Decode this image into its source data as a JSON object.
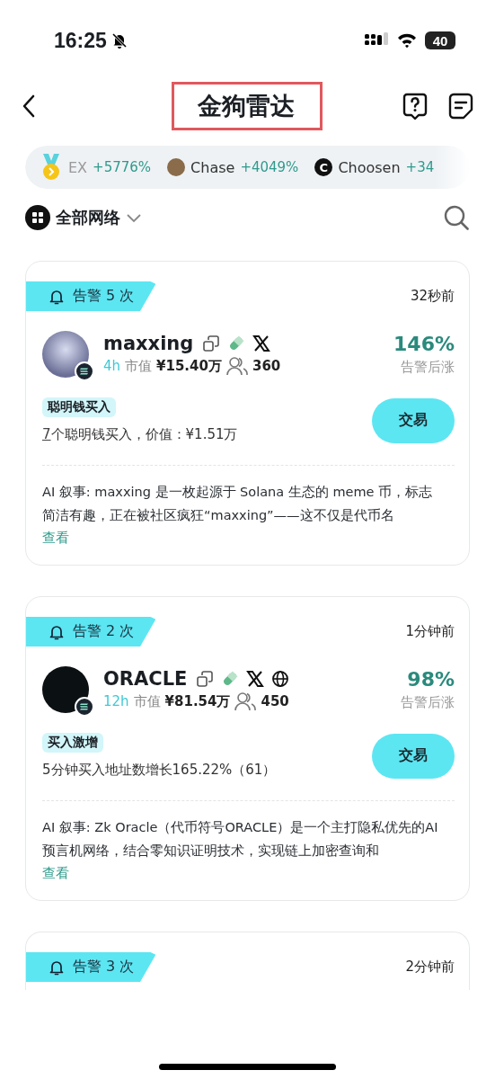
{
  "status_bar": {
    "time": "16:25",
    "battery": "40"
  },
  "header": {
    "title": "金狗雷达"
  },
  "ticker": [
    {
      "kind": "medal",
      "name": "EX",
      "change": "+5776%"
    },
    {
      "kind": "photo",
      "name": "Chase",
      "change": "+4049%"
    },
    {
      "kind": "letter",
      "name": "Choosen",
      "change": "+34",
      "logo": "C"
    }
  ],
  "network_filter": {
    "label": "全部网络"
  },
  "cards": [
    {
      "alert": "告警 5 次",
      "time": "32秒前",
      "kind": "photo",
      "name": "maxxing",
      "links": [
        {
          "kind": "copy"
        },
        {
          "kind": "pill"
        },
        {
          "kind": "x"
        }
      ],
      "age": "4h",
      "mcap_label": "市值",
      "mcap": "¥15.40万",
      "holders": "360",
      "gain": "146%",
      "gain_label": "告警后涨",
      "tag": "聪明钱买入",
      "detail_link": "7",
      "detail": "个聪明钱买入，价值：¥1.51万",
      "trade": "交易",
      "description": "AI 叙事: maxxing 是一枚起源于 Solana 生态的 meme 币，标志简洁有趣，正在被社区疯狂“maxxing”——这不仅是代币名",
      "more": "查看"
    },
    {
      "alert": "告警 2 次",
      "time": "1分钟前",
      "kind": "dark",
      "name": "ORACLE",
      "links": [
        {
          "kind": "copy"
        },
        {
          "kind": "pill"
        },
        {
          "kind": "x"
        },
        {
          "kind": "globe"
        }
      ],
      "age": "12h",
      "mcap_label": "市值",
      "mcap": "¥81.54万",
      "holders": "450",
      "gain": "98%",
      "gain_label": "告警后涨",
      "tag": "买入激增",
      "detail": "5分钟买入地址数增长165.22%（61）",
      "trade": "交易",
      "description": "AI 叙事: Zk Oracle（代币符号ORACLE）是一个主打隐私优先的AI预言机网络，结合零知识证明技术，实现链上加密查询和",
      "more": "查看"
    },
    {
      "alert": "告警 3 次",
      "time": "2分钟前"
    }
  ]
}
